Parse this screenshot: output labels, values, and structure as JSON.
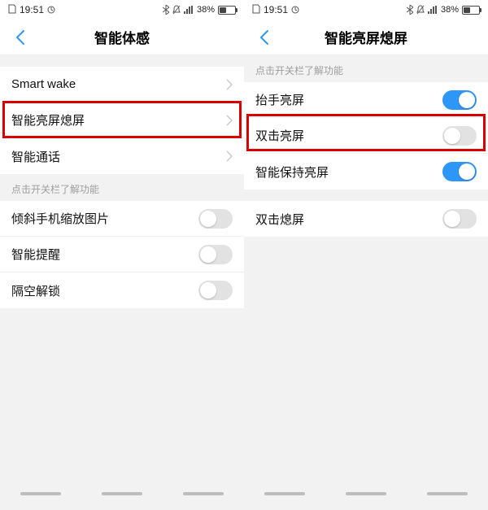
{
  "status": {
    "time": "19:51",
    "battery_pct": "38%"
  },
  "left": {
    "title": "智能体感",
    "nav": {
      "smart_wake": "Smart wake",
      "screen_onoff": "智能亮屏熄屏",
      "smart_call": "智能通话"
    },
    "section_label": "点击开关栏了解功能",
    "toggles": {
      "tilt_zoom": "倾斜手机缩放图片",
      "smart_remind": "智能提醒",
      "air_unlock": "隔空解锁"
    }
  },
  "right": {
    "title": "智能亮屏熄屏",
    "section_label": "点击开关栏了解功能",
    "toggles": {
      "raise_wake": "抬手亮屏",
      "double_tap_wake": "双击亮屏",
      "smart_keep_on": "智能保持亮屏",
      "double_tap_off": "双击熄屏"
    }
  }
}
